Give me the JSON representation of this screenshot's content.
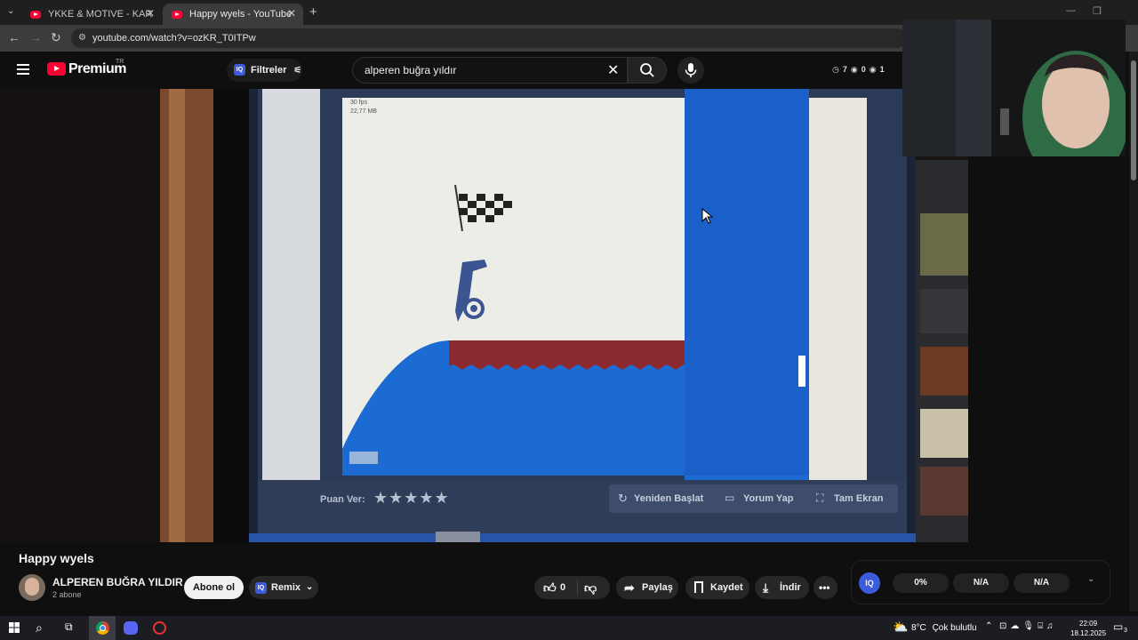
{
  "browser": {
    "tabs": [
      {
        "title": "YKKE & MOTIVE - KARANLIK (C",
        "active": false
      },
      {
        "title": "Happy wyels - YouTube",
        "active": true
      }
    ],
    "new_tab": "+",
    "url": "youtube.com/watch?v=ozKR_T0ITPw"
  },
  "youtube": {
    "logo_text": "Premium",
    "country_code": "TR",
    "filters_label": "Filtreler",
    "search_value": "alperen buğra yıldır",
    "stats": {
      "history": "7",
      "views": "0",
      "other": "1"
    }
  },
  "video_content": {
    "fps_text": "30 fps",
    "kb_text": "22,77 MB",
    "rate_label": "Puan Ver:",
    "restart_label": "Yeniden Başlat",
    "comment_label": "Yorum Yap",
    "fullscreen_label": "Tam Ekran"
  },
  "video": {
    "title": "Happy wyels",
    "channel": "ALPEREN BUĞRA YILDIR",
    "subscribers": "2 abone",
    "subscribe_label": "Abone ol",
    "remix_label": "Remix",
    "likes": "0",
    "share_label": "Paylaş",
    "save_label": "Kaydet",
    "download_label": "İndir"
  },
  "iq_panel": {
    "badge": "IQ",
    "values": [
      "0%",
      "N/A",
      "N/A"
    ]
  },
  "taskbar": {
    "temperature": "8°C",
    "weather": "Çok bulutlu",
    "time": "22:09",
    "date": "18.12.2025",
    "notifications": "3"
  }
}
